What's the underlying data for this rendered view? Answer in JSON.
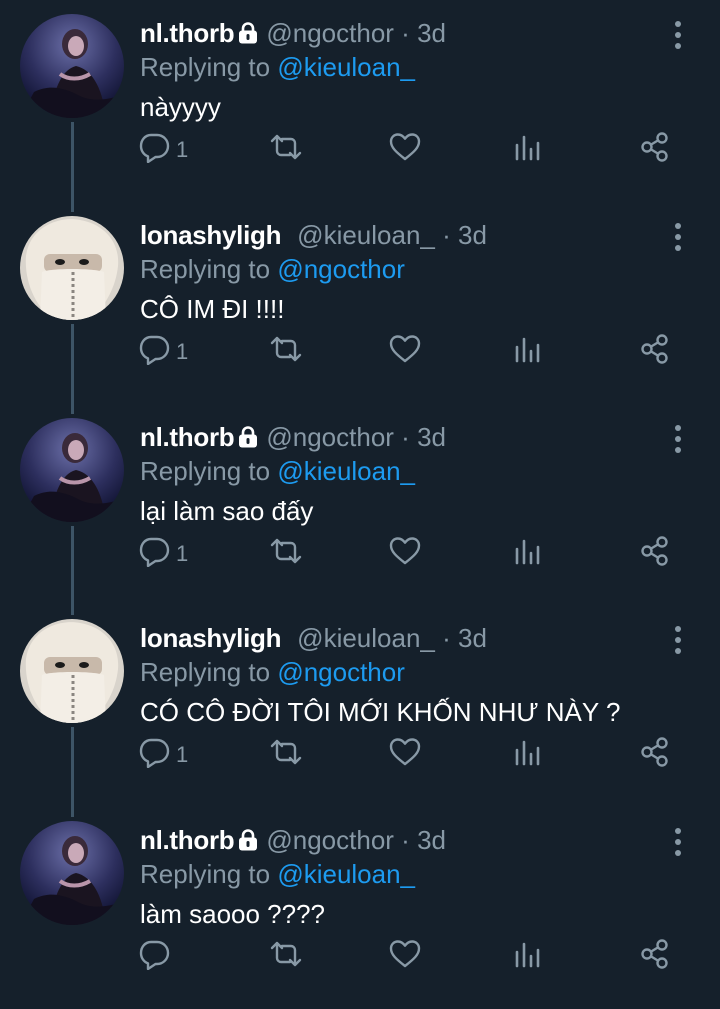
{
  "colors": {
    "background": "#15202b",
    "text_primary": "#ffffff",
    "text_secondary": "#8899a6",
    "mention": "#1d9bf0",
    "thread_line": "#3d5466"
  },
  "tweets": [
    {
      "display_name": "nl.thorb",
      "locked": true,
      "handle": "@ngocthor",
      "separator": "·",
      "time": "3d",
      "replying_prefix": "Replying to",
      "replying_to": "@kieuloan_",
      "text": "nàyyyy",
      "reply_count": "1",
      "avatar": "dark-portrait"
    },
    {
      "display_name": "lonashyligh",
      "locked": false,
      "handle": "@kieuloan_",
      "separator": "·",
      "time": "3d",
      "replying_prefix": "Replying to",
      "replying_to": "@ngocthor",
      "text": "CÔ IM ĐI !!!!",
      "reply_count": "1",
      "avatar": "hood-portrait"
    },
    {
      "display_name": "nl.thorb",
      "locked": true,
      "handle": "@ngocthor",
      "separator": "·",
      "time": "3d",
      "replying_prefix": "Replying to",
      "replying_to": "@kieuloan_",
      "text": "lại làm sao đấy",
      "reply_count": "1",
      "avatar": "dark-portrait"
    },
    {
      "display_name": "lonashyligh",
      "locked": false,
      "handle": "@kieuloan_",
      "separator": "·",
      "time": "3d",
      "replying_prefix": "Replying to",
      "replying_to": "@ngocthor",
      "text": "CÓ CÔ ĐỜI TÔI MỚI KHỐN NHƯ NÀY ?",
      "reply_count": "1",
      "avatar": "hood-portrait"
    },
    {
      "display_name": "nl.thorb",
      "locked": true,
      "handle": "@ngocthor",
      "separator": "·",
      "time": "3d",
      "replying_prefix": "Replying to",
      "replying_to": "@kieuloan_",
      "text": "làm saooo ????",
      "reply_count": "",
      "avatar": "dark-portrait"
    }
  ],
  "icons": {
    "reply": "reply-icon",
    "retweet": "retweet-icon",
    "like": "heart-icon",
    "stats": "analytics-icon",
    "share": "share-icon",
    "more": "more-vertical-icon",
    "lock": "lock-icon"
  }
}
